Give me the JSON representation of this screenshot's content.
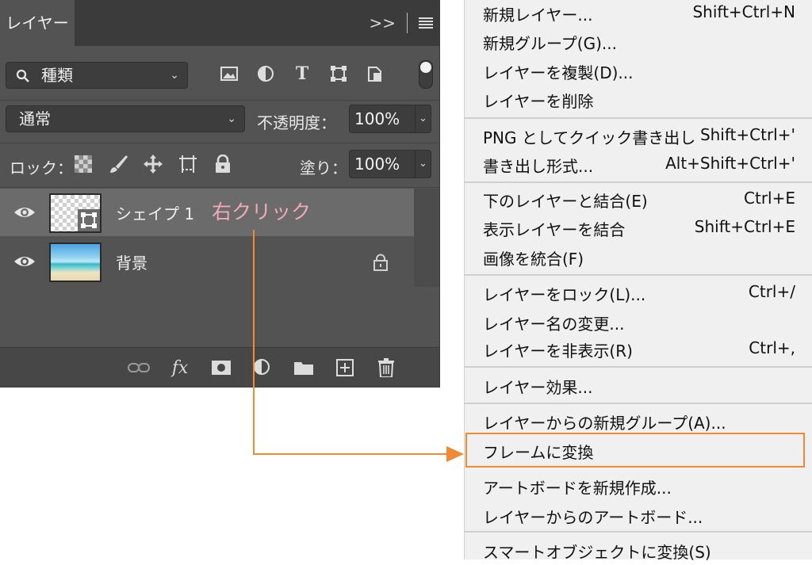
{
  "panel": {
    "tab_label": "レイヤー",
    "tab_expand": ">>",
    "filter": {
      "label": "種類",
      "icons": [
        "image-filter-icon",
        "adjustment-filter-icon",
        "type-filter-icon",
        "shape-filter-icon",
        "smart-object-filter-icon"
      ]
    },
    "blend_mode": "通常",
    "opacity_label": "不透明度：",
    "opacity_value": "100%",
    "lock_label": "ロック：",
    "fill_label": "塗り：",
    "fill_value": "100%",
    "layers": [
      {
        "name": "シェイプ 1",
        "selected": true
      },
      {
        "name": "背景",
        "locked": true
      }
    ],
    "annotation": "右クリック"
  },
  "context_menu": {
    "groups": [
      [
        {
          "label": "新規レイヤー...",
          "shortcut": "Shift+Ctrl+N"
        },
        {
          "label": "新規グループ(G)...",
          "shortcut": ""
        },
        {
          "label": "レイヤーを複製(D)...",
          "shortcut": ""
        },
        {
          "label": "レイヤーを削除",
          "shortcut": ""
        }
      ],
      [
        {
          "label": "PNG としてクイック書き出し",
          "shortcut": "Shift+Ctrl+'"
        },
        {
          "label": "書き出し形式...",
          "shortcut": "Alt+Shift+Ctrl+'"
        }
      ],
      [
        {
          "label": "下のレイヤーと結合(E)",
          "shortcut": "Ctrl+E"
        },
        {
          "label": "表示レイヤーを結合",
          "shortcut": "Shift+Ctrl+E"
        },
        {
          "label": "画像を統合(F)",
          "shortcut": ""
        }
      ],
      [
        {
          "label": "レイヤーをロック(L)...",
          "shortcut": "Ctrl+/"
        },
        {
          "label": "レイヤー名の変更...",
          "shortcut": ""
        },
        {
          "label": "レイヤーを非表示(R)",
          "shortcut": "Ctrl+,"
        }
      ],
      [
        {
          "label": "レイヤー効果...",
          "shortcut": ""
        }
      ],
      [
        {
          "label": "レイヤーからの新規グループ(A)...",
          "shortcut": ""
        },
        {
          "label": "フレームに変換",
          "shortcut": "",
          "highlighted": true
        },
        {
          "label": "アートボードを新規作成...",
          "shortcut": ""
        },
        {
          "label": "レイヤーからのアートボード...",
          "shortcut": ""
        }
      ],
      [
        {
          "label": "スマートオブジェクトに変換(S)",
          "shortcut": ""
        }
      ]
    ]
  },
  "colors": {
    "panel_bg": "#535353",
    "selected_row": "#6b6b6b",
    "accent_orange": "#f08a35",
    "annotation_pink": "#f2a9b5"
  }
}
